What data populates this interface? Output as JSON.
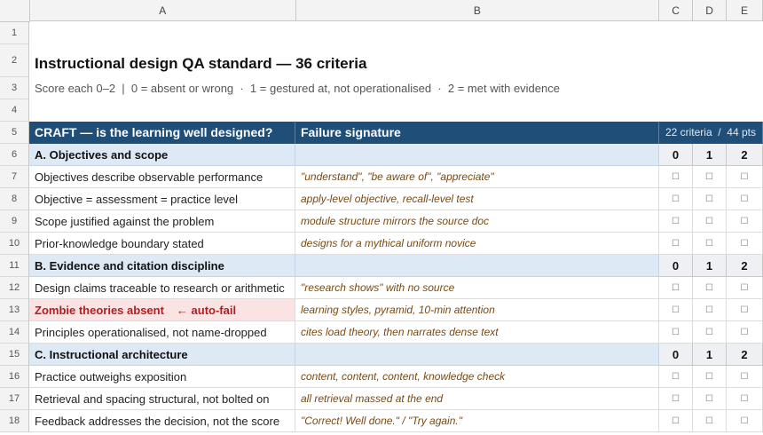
{
  "columns": [
    "A",
    "B",
    "C",
    "D",
    "E"
  ],
  "rows": [
    "1",
    "2",
    "3",
    "4",
    "5",
    "6",
    "7",
    "8",
    "9",
    "10",
    "11",
    "12",
    "13",
    "14",
    "15",
    "16",
    "17",
    "18"
  ],
  "title": "Instructional design QA standard — 36 criteria",
  "subtitle": "Score each 0–2  |  0 = absent or wrong  ·  1 = gestured at, not operationalised  ·  2 = met with evidence",
  "band": {
    "label": "CRAFT — is the learning well designed?",
    "signature_header": "Failure signature",
    "criteria_count": "22 criteria  /  44 pts"
  },
  "score_labels": [
    "0",
    "1",
    "2"
  ],
  "checkbox": "☐",
  "sections": [
    {
      "title": "A. Objectives and scope",
      "items": [
        {
          "criterion": "Objectives describe observable performance",
          "signature": "\"understand\", \"be aware of\", \"appreciate\""
        },
        {
          "criterion": "Objective = assessment = practice level",
          "signature": "apply-level objective, recall-level test"
        },
        {
          "criterion": "Scope justified against the problem",
          "signature": "module structure mirrors the source doc"
        },
        {
          "criterion": "Prior-knowledge boundary stated",
          "signature": "designs for a mythical uniform novice"
        }
      ]
    },
    {
      "title": "B. Evidence and citation discipline",
      "items": [
        {
          "criterion": "Design claims traceable to research or arithmetic",
          "signature": "\"research shows\" with no source"
        },
        {
          "criterion": "Zombie theories absent",
          "flag": "← auto-fail",
          "signature": "learning styles, pyramid, 10-min attention"
        },
        {
          "criterion": "Principles operationalised, not name-dropped",
          "signature": "cites load theory, then narrates dense text"
        }
      ]
    },
    {
      "title": "C. Instructional architecture",
      "items": [
        {
          "criterion": "Practice outweighs exposition",
          "signature": "content, content, content, knowledge check"
        },
        {
          "criterion": "Retrieval and spacing structural, not bolted on",
          "signature": "all retrieval massed at the end"
        },
        {
          "criterion": "Feedback addresses the decision, not the score",
          "signature": "\"Correct! Well done.\" / \"Try again.\""
        }
      ]
    }
  ]
}
